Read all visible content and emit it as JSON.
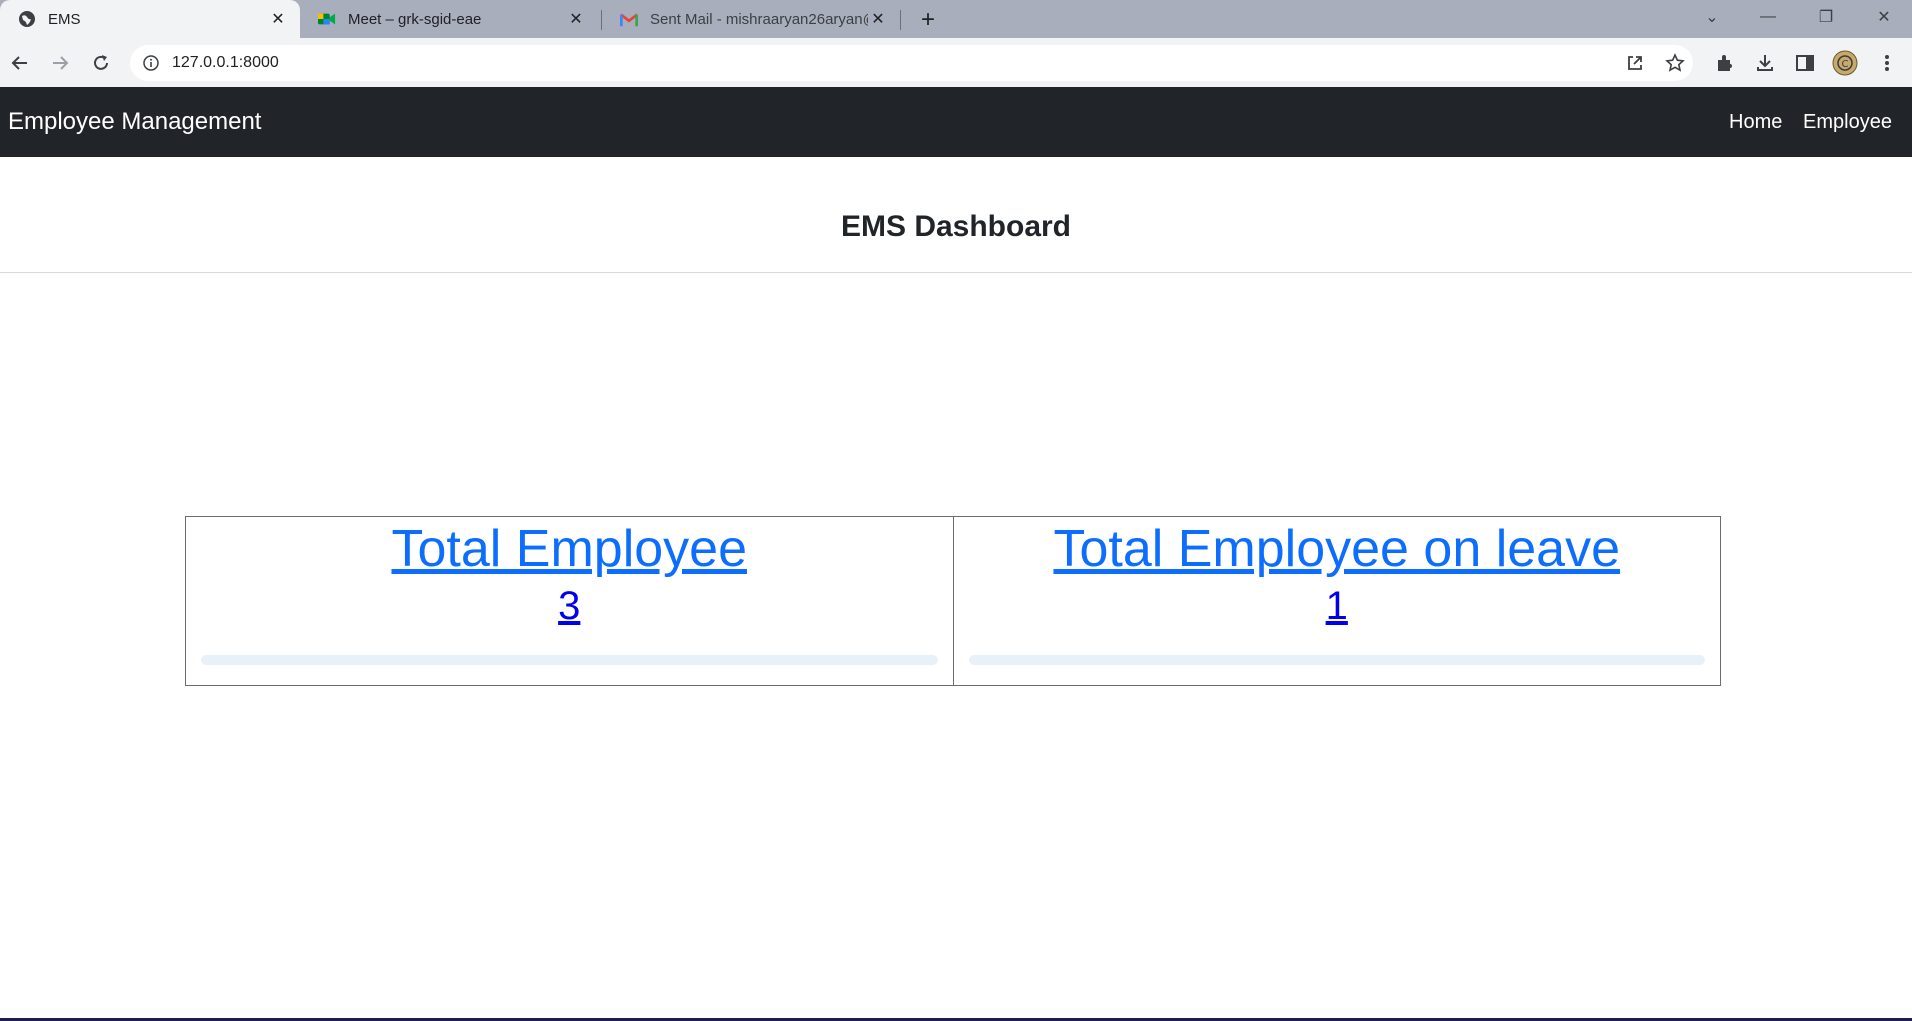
{
  "browser": {
    "tabs": [
      {
        "title": "EMS",
        "icon": "globe-icon",
        "active": true
      },
      {
        "title": "Meet – grk-sgid-eae",
        "icon": "meet-icon",
        "active": false
      },
      {
        "title": "Sent Mail - mishraaryan26aryan@",
        "icon": "gmail-icon",
        "active": false
      }
    ],
    "url": "127.0.0.1:8000"
  },
  "navbar": {
    "brand": "Employee Management",
    "links": [
      "Home",
      "Employee"
    ]
  },
  "page": {
    "title": "EMS Dashboard"
  },
  "cards": [
    {
      "title": "Total Employee",
      "value": "3"
    },
    {
      "title": "Total Employee on leave",
      "value": "1"
    }
  ],
  "colors": {
    "navbar_bg": "#212529",
    "link_primary": "#0d6efd",
    "link_visited": "#0000ee"
  }
}
